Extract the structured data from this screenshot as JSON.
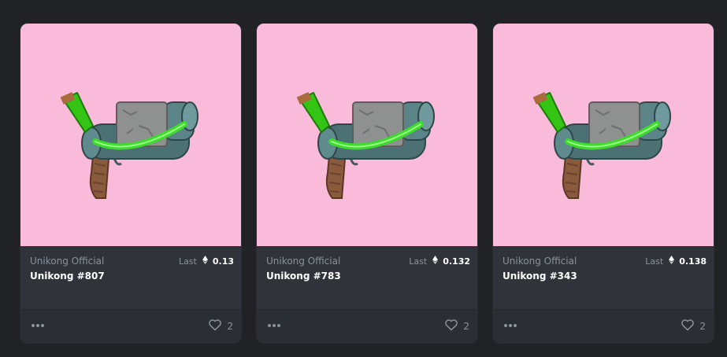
{
  "colors": {
    "page_bg": "#202225",
    "card_bg": "#303339",
    "media_bg": "#f9bbd9",
    "muted_text": "#8a939b",
    "primary_text": "#ffffff"
  },
  "icons": {
    "more": "more-dots-icon",
    "like": "heart-icon",
    "currency": "ethereum-icon"
  },
  "cards": [
    {
      "collection": "Unikong Official",
      "name": "Unikong #807",
      "price_label": "Last",
      "price_value": "0.13",
      "likes": "2"
    },
    {
      "collection": "Unikong Official",
      "name": "Unikong #783",
      "price_label": "Last",
      "price_value": "0.132",
      "likes": "2"
    },
    {
      "collection": "Unikong Official",
      "name": "Unikong #343",
      "price_label": "Last",
      "price_value": "0.138",
      "likes": "2"
    }
  ]
}
